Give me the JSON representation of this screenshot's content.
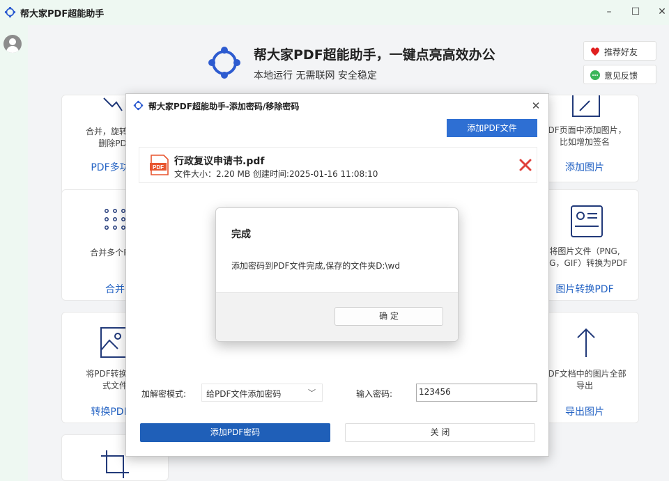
{
  "window": {
    "title": "帮大家PDF超能助手",
    "controls": {
      "minimize": "–",
      "maximize": "☐",
      "close": "✕"
    }
  },
  "hero": {
    "title": "帮大家PDF超能助手，一键点亮高效办公",
    "subtitle": "本地运行 无需联网 安全稳定"
  },
  "side_buttons": {
    "recommend": "推荐好友",
    "feedback": "意见反馈"
  },
  "cards": {
    "c1": {
      "desc": "合并，旋转，重\n删除PDF",
      "link": "PDF多功能"
    },
    "c2": {
      "desc": "合并多个PDF",
      "link": "合并"
    },
    "c3": {
      "desc": "将PDF转换为图\n式文件",
      "link": "转换PDF为"
    },
    "r1": {
      "desc": "PDF页面中添加图片，\n比如增加签名",
      "link": "添加图片"
    },
    "r2": {
      "desc": "将图片文件（PNG,\nJPG，GIF）转换为PDF",
      "link": "图片转换PDF"
    },
    "r3": {
      "desc": "PDF文档中的图片全部\n导出",
      "link": "导出图片"
    }
  },
  "dialog": {
    "title": "帮大家PDF超能助手-添加密码/移除密码",
    "close": "✕",
    "add_file_label": "添加PDF文件",
    "file": {
      "name": "行政复议申请书.pdf",
      "meta": "文件大小：2.20 MB 创建时间:2025-01-16 11:08:10",
      "icon_text": "PDF"
    },
    "mode_label": "加解密模式:",
    "mode_value": "给PDF文件添加密码",
    "password_label": "输入密码:",
    "password_value": "123456",
    "primary_label": "添加PDF密码",
    "close_label": "关 闭"
  },
  "alert": {
    "title": "完成",
    "message": "添加密码到PDF文件完成,保存的文件夹D:\\wd",
    "ok_label": "确 定"
  },
  "colors": {
    "accent": "#2e6fd3",
    "primary_button": "#1f5fb8",
    "link": "#2463c4",
    "delete": "#e0403a",
    "pdf_icon": "#e8552f"
  }
}
